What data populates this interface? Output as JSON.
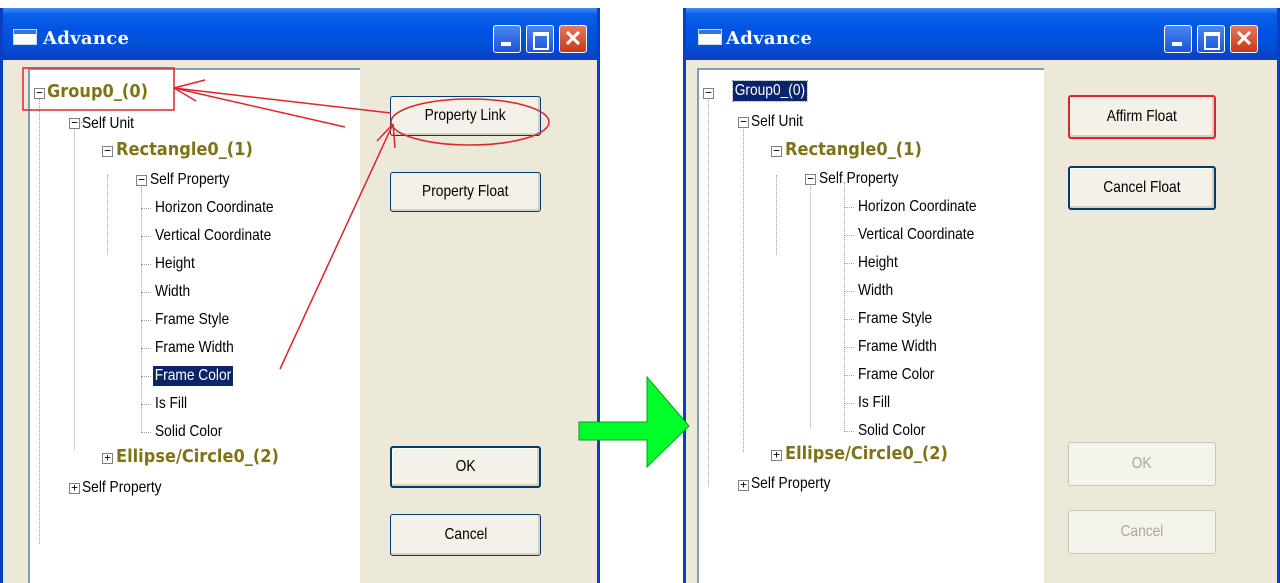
{
  "left": {
    "title": "Advance",
    "buttons": {
      "property_link": "Property Link",
      "property_float": "Property Float",
      "ok": "OK",
      "cancel": "Cancel"
    }
  },
  "right": {
    "title": "Advance",
    "buttons": {
      "affirm_float": "Affirm Float",
      "cancel_float": "Cancel Float",
      "ok": "OK",
      "cancel": "Cancel"
    }
  },
  "tree": {
    "group": "Group0_(0)",
    "self_unit": "Self Unit",
    "rectangle": "Rectangle0_(1)",
    "self_property": "Self Property",
    "props": [
      "Horizon Coordinate",
      "Vertical Coordinate",
      "Height",
      "Width",
      "Frame Style",
      "Frame Width",
      "Frame Color",
      "Is Fill",
      "Solid Color"
    ],
    "ellipse": "Ellipse/Circle0_(2)",
    "self_property_root": "Self Property"
  },
  "colors": {
    "titlebar": "#0054e3",
    "selection": "#0a246a",
    "node_bold": "#7d7418",
    "annotation_red": "#e0242c",
    "arrow_green": "#00ff2a"
  },
  "icons": {
    "minimize": "minimize-icon",
    "maximize": "maximize-icon",
    "close": "close-icon",
    "window": "window-icon",
    "transition_arrow": "arrow-right-icon"
  }
}
